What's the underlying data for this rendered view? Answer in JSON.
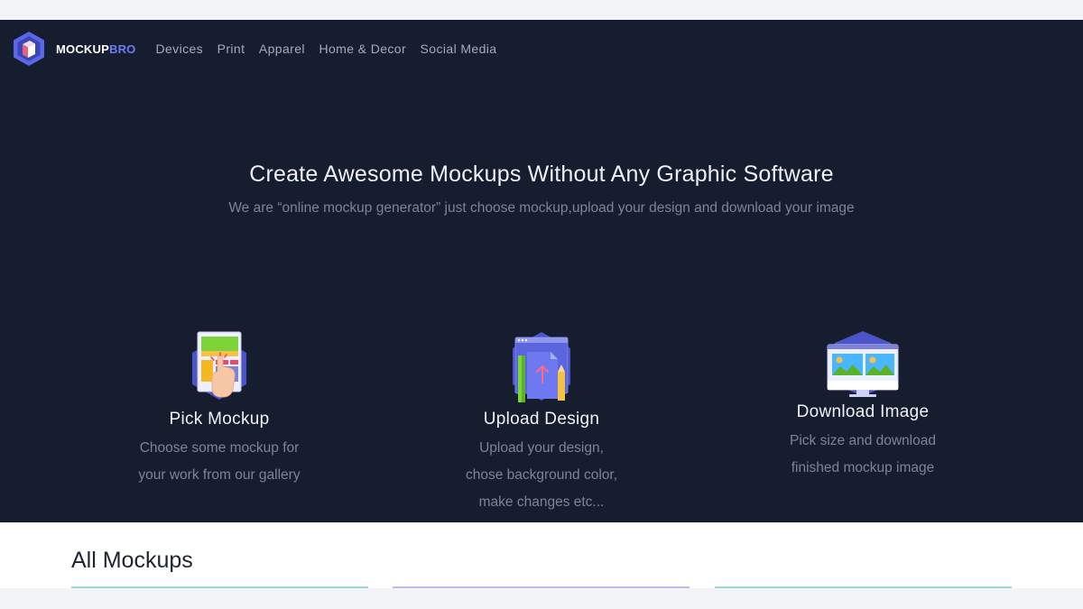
{
  "brand": {
    "name_part1": "MOCKUP",
    "name_part2": "BRO",
    "icon": "mockupbro-logo-icon"
  },
  "nav": {
    "items": [
      {
        "label": "Devices"
      },
      {
        "label": "Print"
      },
      {
        "label": "Apparel"
      },
      {
        "label": "Home & Decor"
      },
      {
        "label": "Social Media"
      }
    ]
  },
  "hero": {
    "title": "Create Awesome Mockups Without Any Graphic Software",
    "subtitle": "We are “online mockup generator” just choose mockup,upload your design and download your image"
  },
  "features": [
    {
      "icon": "pick-mockup-icon",
      "title": "Pick Mockup",
      "desc_lines": [
        "Choose some mockup for",
        "your work from our gallery"
      ]
    },
    {
      "icon": "upload-design-icon",
      "title": "Upload Design",
      "desc_lines": [
        "Upload your design,",
        "chose background color,",
        "make changes etc..."
      ]
    },
    {
      "icon": "download-image-icon",
      "title": "Download Image",
      "desc_lines": [
        "Pick size and download",
        "finished mockup image"
      ]
    }
  ],
  "section": {
    "title": "All Mockups"
  },
  "colors": {
    "hero_bg": "#161d2f",
    "page_bg": "#f2f3f7",
    "accent": "#6e7cf7",
    "card_accents": [
      "#9fd6d8",
      "#c5b6f2",
      "#9fd6d8"
    ]
  }
}
